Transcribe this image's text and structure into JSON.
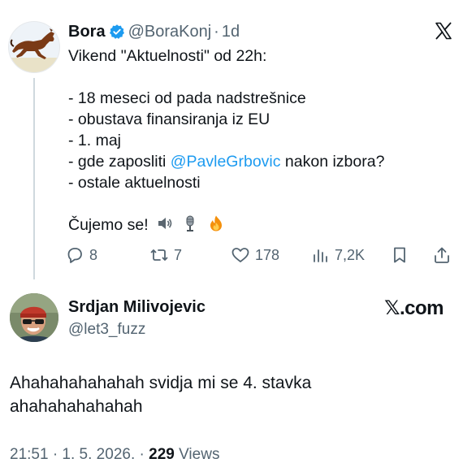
{
  "quoted_tweet": {
    "author_name": "Bora",
    "handle": "@BoraKonj",
    "separator": "·",
    "time": "1d",
    "lines": [
      "Vikend \"Aktuelnosti\" od 22h:",
      "",
      "- 18 meseci od pada nadstrešnice",
      "- obustava finansiranja iz EU",
      "- 1. maj"
    ],
    "mention_line": {
      "prefix": "- gde zaposliti ",
      "mention": "@PavleGrbovic",
      "suffix": " nakon izbora?"
    },
    "last_line": "- ostale aktuelnosti",
    "sign_off": "Čujemo se!",
    "emojis": [
      "speaker-icon",
      "microphone-icon",
      "fire-icon"
    ],
    "actions": {
      "replies": "8",
      "reposts": "7",
      "likes": "178",
      "views": "7,2K"
    }
  },
  "reply_tweet": {
    "author_name": "Srdjan Milivojevic",
    "handle": "@let3_fuzz",
    "brand": "𝕏.com",
    "text": "Ahahahahahahah svidja mi se 4. stavka ahahahahahahah",
    "timestamp": "21:51 · 1. 5. 2026. · ",
    "views_count": "229",
    "views_label": " Views"
  },
  "colors": {
    "text": "#0f1419",
    "secondary": "#536471",
    "link": "#1d9bf0",
    "verified": "#1d9bf0"
  }
}
